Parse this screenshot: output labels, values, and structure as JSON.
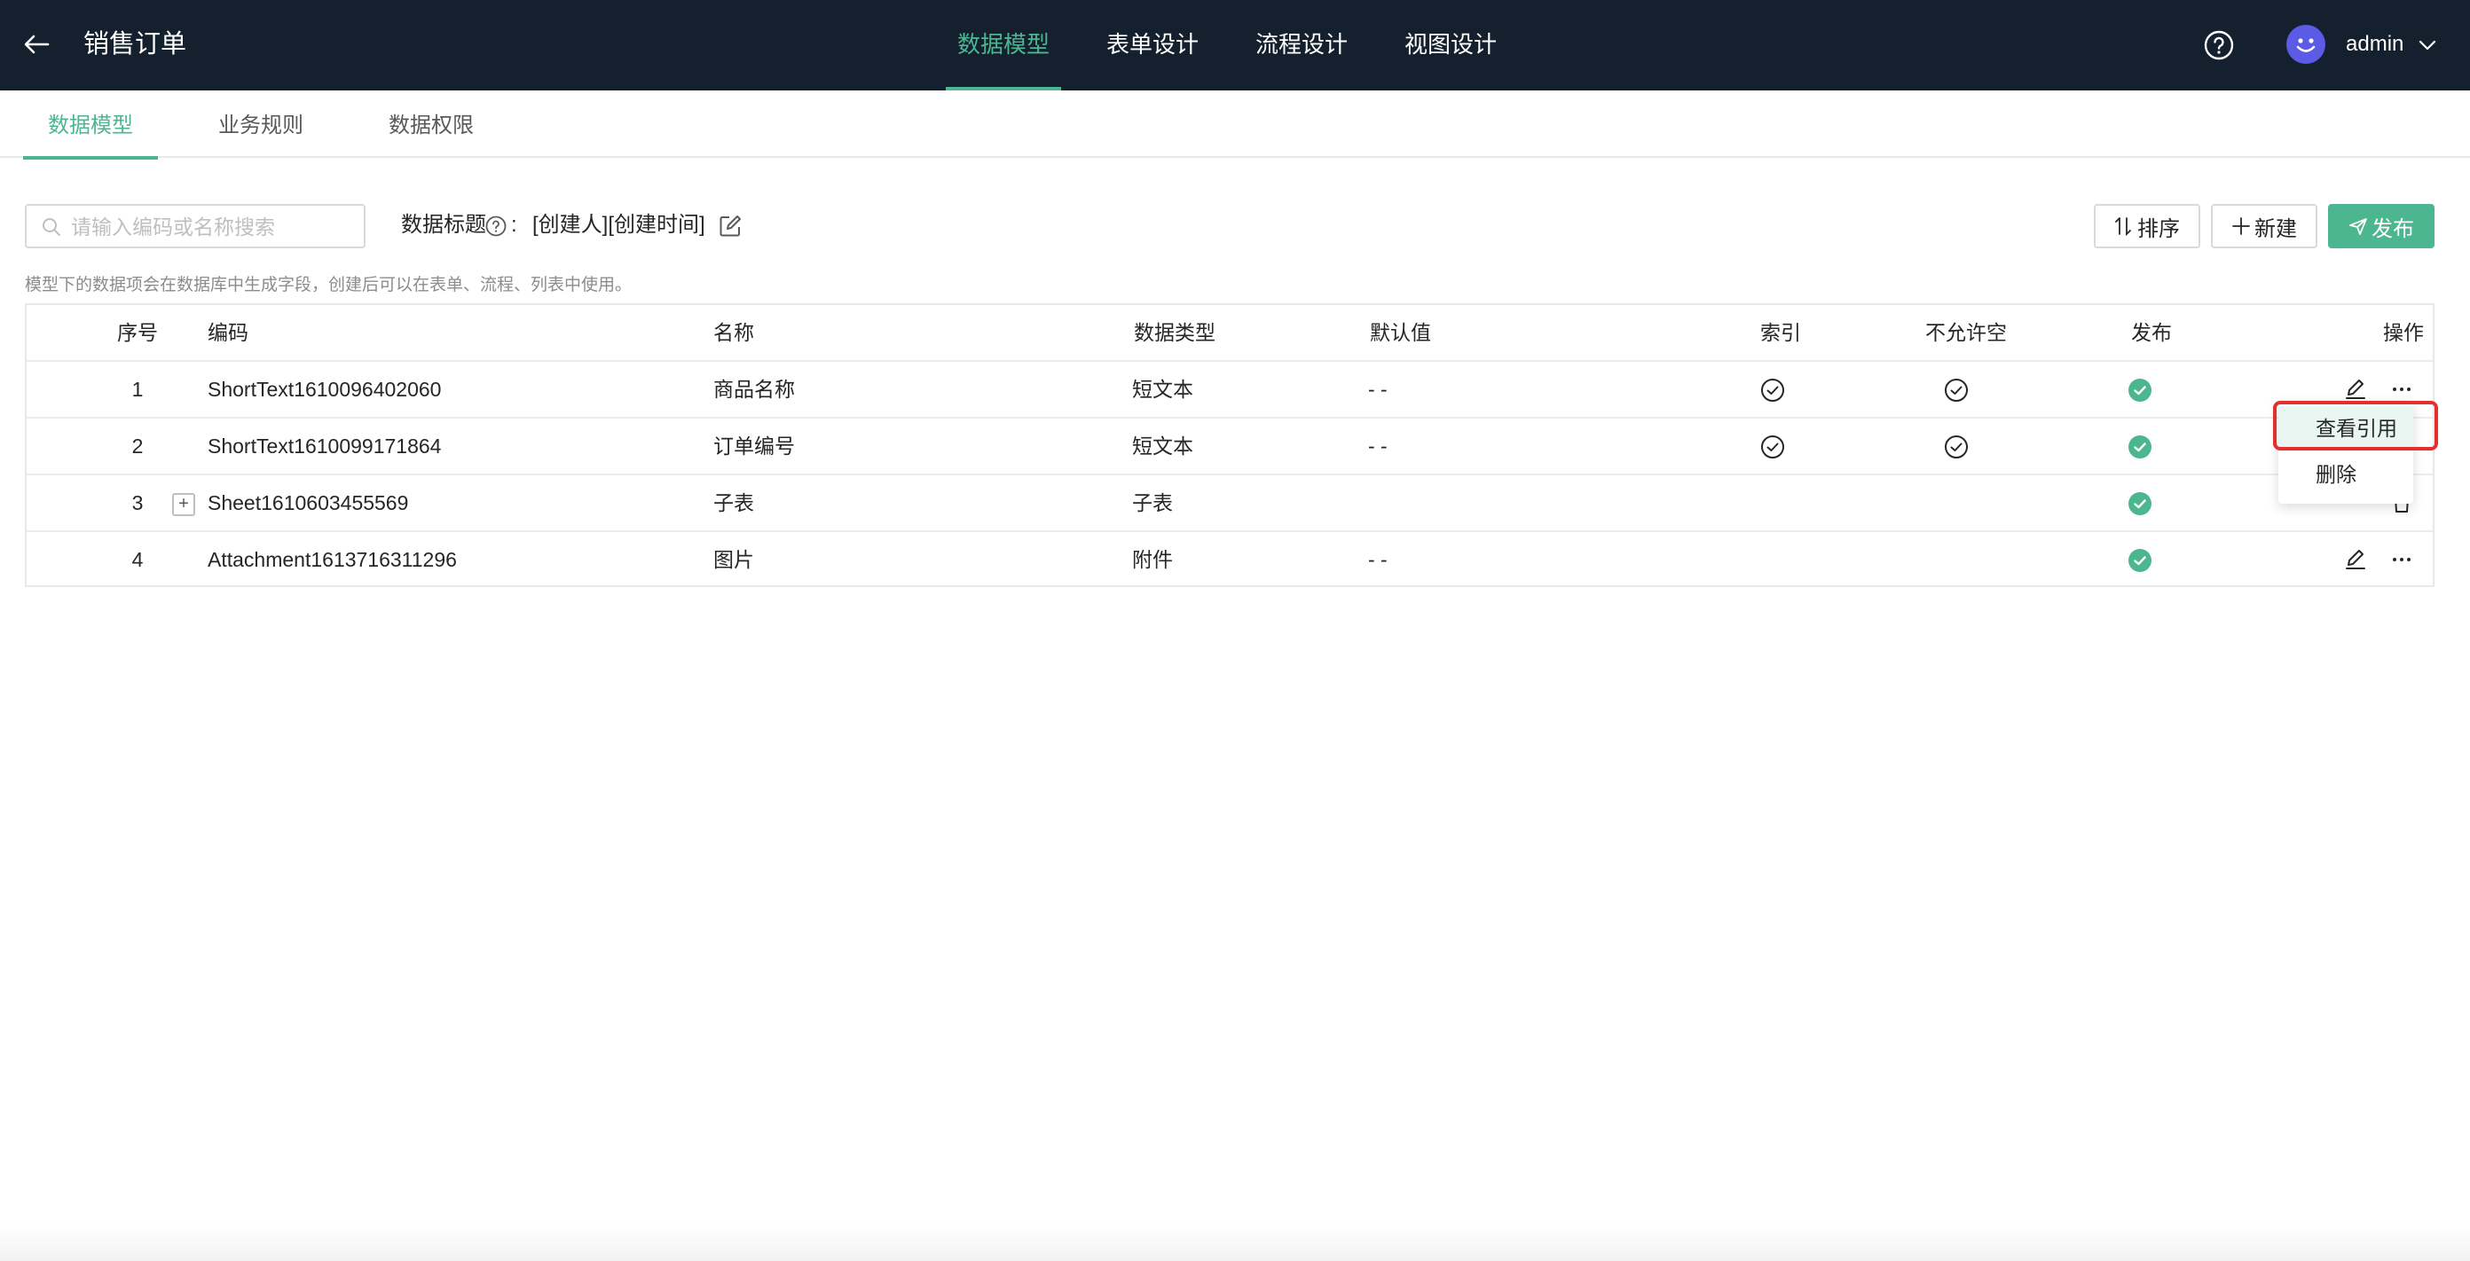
{
  "header": {
    "title": "销售订单",
    "nav": [
      "数据模型",
      "表单设计",
      "流程设计",
      "视图设计"
    ],
    "active_nav": "数据模型",
    "user": "admin"
  },
  "subtabs": [
    "数据模型",
    "业务规则",
    "数据权限"
  ],
  "toolbar": {
    "search_placeholder": "请输入编码或名称搜索",
    "data_title_label": "数据标题",
    "data_title_colon": ":",
    "data_title_value": "[创建人][创建时间]",
    "sort_label": "排序",
    "new_label": "新建",
    "publish_label": "发布"
  },
  "hint": "模型下的数据项会在数据库中生成字段，创建后可以在表单、流程、列表中使用。",
  "table": {
    "columns": [
      "序号",
      "编码",
      "名称",
      "数据类型",
      "默认值",
      "索引",
      "不允许空",
      "发布",
      "操作"
    ],
    "rows": [
      {
        "no": "1",
        "code": "ShortText1610096402060",
        "name": "商品名称",
        "type": "短文本",
        "default": "- -",
        "index": true,
        "not_null": true,
        "published": true
      },
      {
        "no": "2",
        "code": "ShortText1610099171864",
        "name": "订单编号",
        "type": "短文本",
        "default": "- -",
        "index": true,
        "not_null": true,
        "published": true
      },
      {
        "no": "3",
        "code": "Sheet1610603455569",
        "name": "子表",
        "type": "子表",
        "default": "",
        "index": false,
        "not_null": false,
        "published": true
      },
      {
        "no": "4",
        "code": "Attachment1613716311296",
        "name": "图片",
        "type": "附件",
        "default": "- -",
        "index": false,
        "not_null": false,
        "published": true
      }
    ]
  },
  "dropdown": {
    "items": [
      "查看引用",
      "删除"
    ]
  },
  "colors": {
    "header_bg": "#15202e",
    "accent": "#4bb68f",
    "highlight": "#e3302f",
    "avatar": "#5b5be6"
  }
}
